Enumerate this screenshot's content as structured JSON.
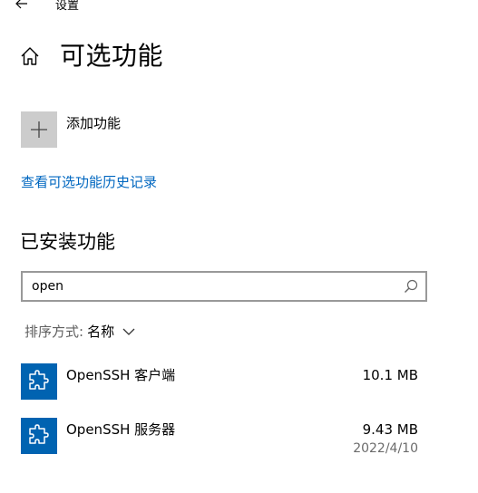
{
  "window": {
    "title": "设置"
  },
  "header": {
    "title": "可选功能"
  },
  "add_feature": {
    "label": "添加功能"
  },
  "history_link": {
    "label": "查看可选功能历史记录"
  },
  "installed": {
    "heading": "已安装功能",
    "search": {
      "value": "open",
      "placeholder": ""
    },
    "sort": {
      "label": "排序方式:",
      "value": "名称"
    },
    "features": [
      {
        "name": "OpenSSH 客户端",
        "size": "10.1 MB",
        "date": ""
      },
      {
        "name": "OpenSSH 服务器",
        "size": "9.43 MB",
        "date": "2022/4/10"
      }
    ]
  },
  "colors": {
    "accent_link": "#0067c0",
    "feature_icon_bg": "#0063b1",
    "add_tile_bg": "#cccccc"
  },
  "icons": {
    "back": "back-arrow-icon",
    "home": "home-icon",
    "add": "plus-icon",
    "search": "search-icon",
    "sort": "chevron-down-icon",
    "feature": "puzzle-piece-icon"
  }
}
